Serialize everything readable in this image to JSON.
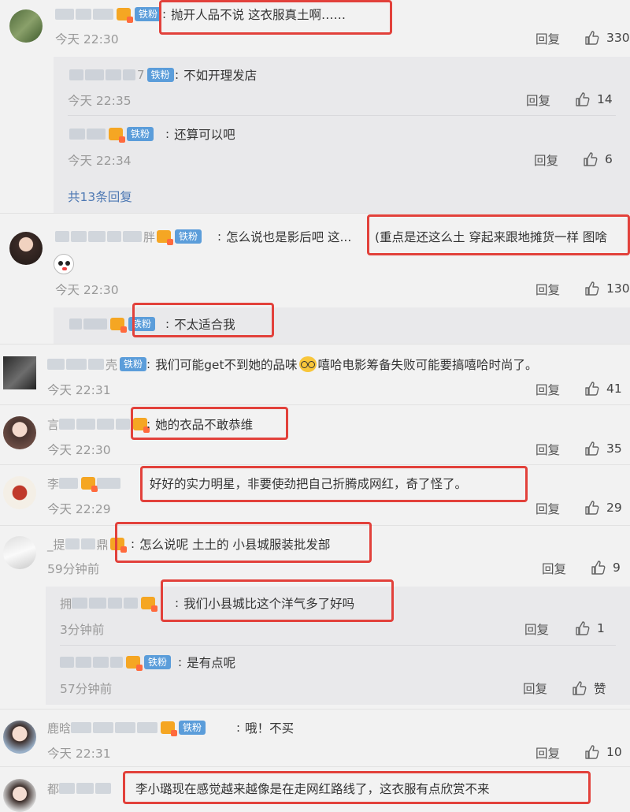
{
  "fan_badge": "铁粉",
  "reply_label": "回复",
  "like_icon": "thumbs-up-icon",
  "highlight_color": "#e2413b",
  "comments": [
    {
      "id": "c1",
      "text": "抛开人品不说 这衣服真土啊……",
      "time": "今天 22:30",
      "likes": "330",
      "replies": [
        {
          "prefix": "7",
          "text": "不如开理发店",
          "time": "今天 22:35",
          "likes": "14"
        },
        {
          "prefix": "",
          "text": "还算可以吧",
          "time": "今天 22:34",
          "likes": "6"
        }
      ],
      "more": "共13条回复"
    },
    {
      "id": "c2",
      "name_suffix": "胖",
      "text": "怎么说也是影后吧 这...",
      "text2": "(重点是还这么土 穿起来跟地摊货一样 图啥",
      "time": "今天 22:30",
      "likes": "130",
      "replies": [
        {
          "text": "不太适合我"
        }
      ]
    },
    {
      "id": "c3",
      "name_suffix": "壳",
      "text": "我们可能get不到她的品味",
      "text2": "嘻哈电影筹备失败可能要搞嘻哈时尚了。",
      "time": "今天 22:31",
      "likes": "41"
    },
    {
      "id": "c4",
      "name_prefix": "言",
      "text": "她的衣品不敢恭维",
      "time": "今天 22:30",
      "likes": "35"
    },
    {
      "id": "c5",
      "name_prefix": "李",
      "text": "好好的实力明星，非要使劲把自己折腾成网红，奇了怪了。",
      "time": "今天 22:29",
      "likes": "29"
    },
    {
      "id": "c6",
      "name_prefix": "_提",
      "name_suffix": "鼎",
      "text": "怎么说呢 土土的 小县城服装批发部",
      "time": "59分钟前",
      "likes": "9",
      "replies": [
        {
          "prefix": "拥",
          "text": "我们小县城比这个洋气多了好吗",
          "time": "3分钟前",
          "likes": "1"
        },
        {
          "text": "是有点呢",
          "time": "57分钟前",
          "likes": "赞"
        }
      ]
    },
    {
      "id": "c7",
      "name_prefix": "鹿晗",
      "text": "哦！不买",
      "time": "今天 22:31",
      "likes": "10"
    },
    {
      "id": "c8",
      "name_prefix": "都",
      "text": "李小璐现在感觉越来越像是在走网红路线了，这衣服有点欣赏不来"
    }
  ]
}
